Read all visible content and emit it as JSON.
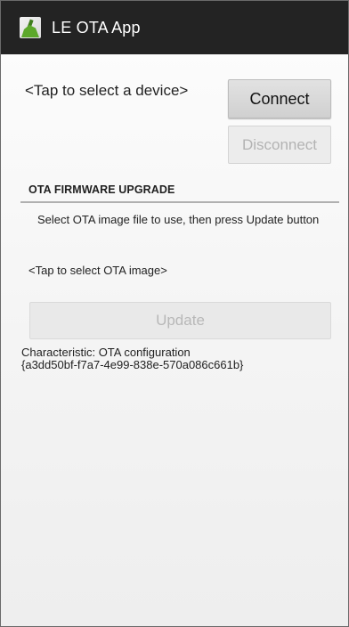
{
  "action_bar": {
    "icon": "android-app-icon",
    "title": "LE OTA App"
  },
  "device": {
    "select_label": "<Tap to select a device>",
    "connect_label": "Connect",
    "disconnect_label": "Disconnect"
  },
  "ota": {
    "section_title": "OTA FIRMWARE UPGRADE",
    "instruction": "Select OTA image file to use, then press Update button",
    "image_select_label": "<Tap to select OTA image>",
    "update_label": "Update"
  },
  "characteristic": {
    "line1": "Characteristic: OTA configuration",
    "line2": "{a3dd50bf-f7a7-4e99-838e-570a086c661b}"
  },
  "colors": {
    "action_bar_bg": "#232323",
    "background": "#f6f6f6",
    "disabled_text": "#b8b8b8"
  }
}
